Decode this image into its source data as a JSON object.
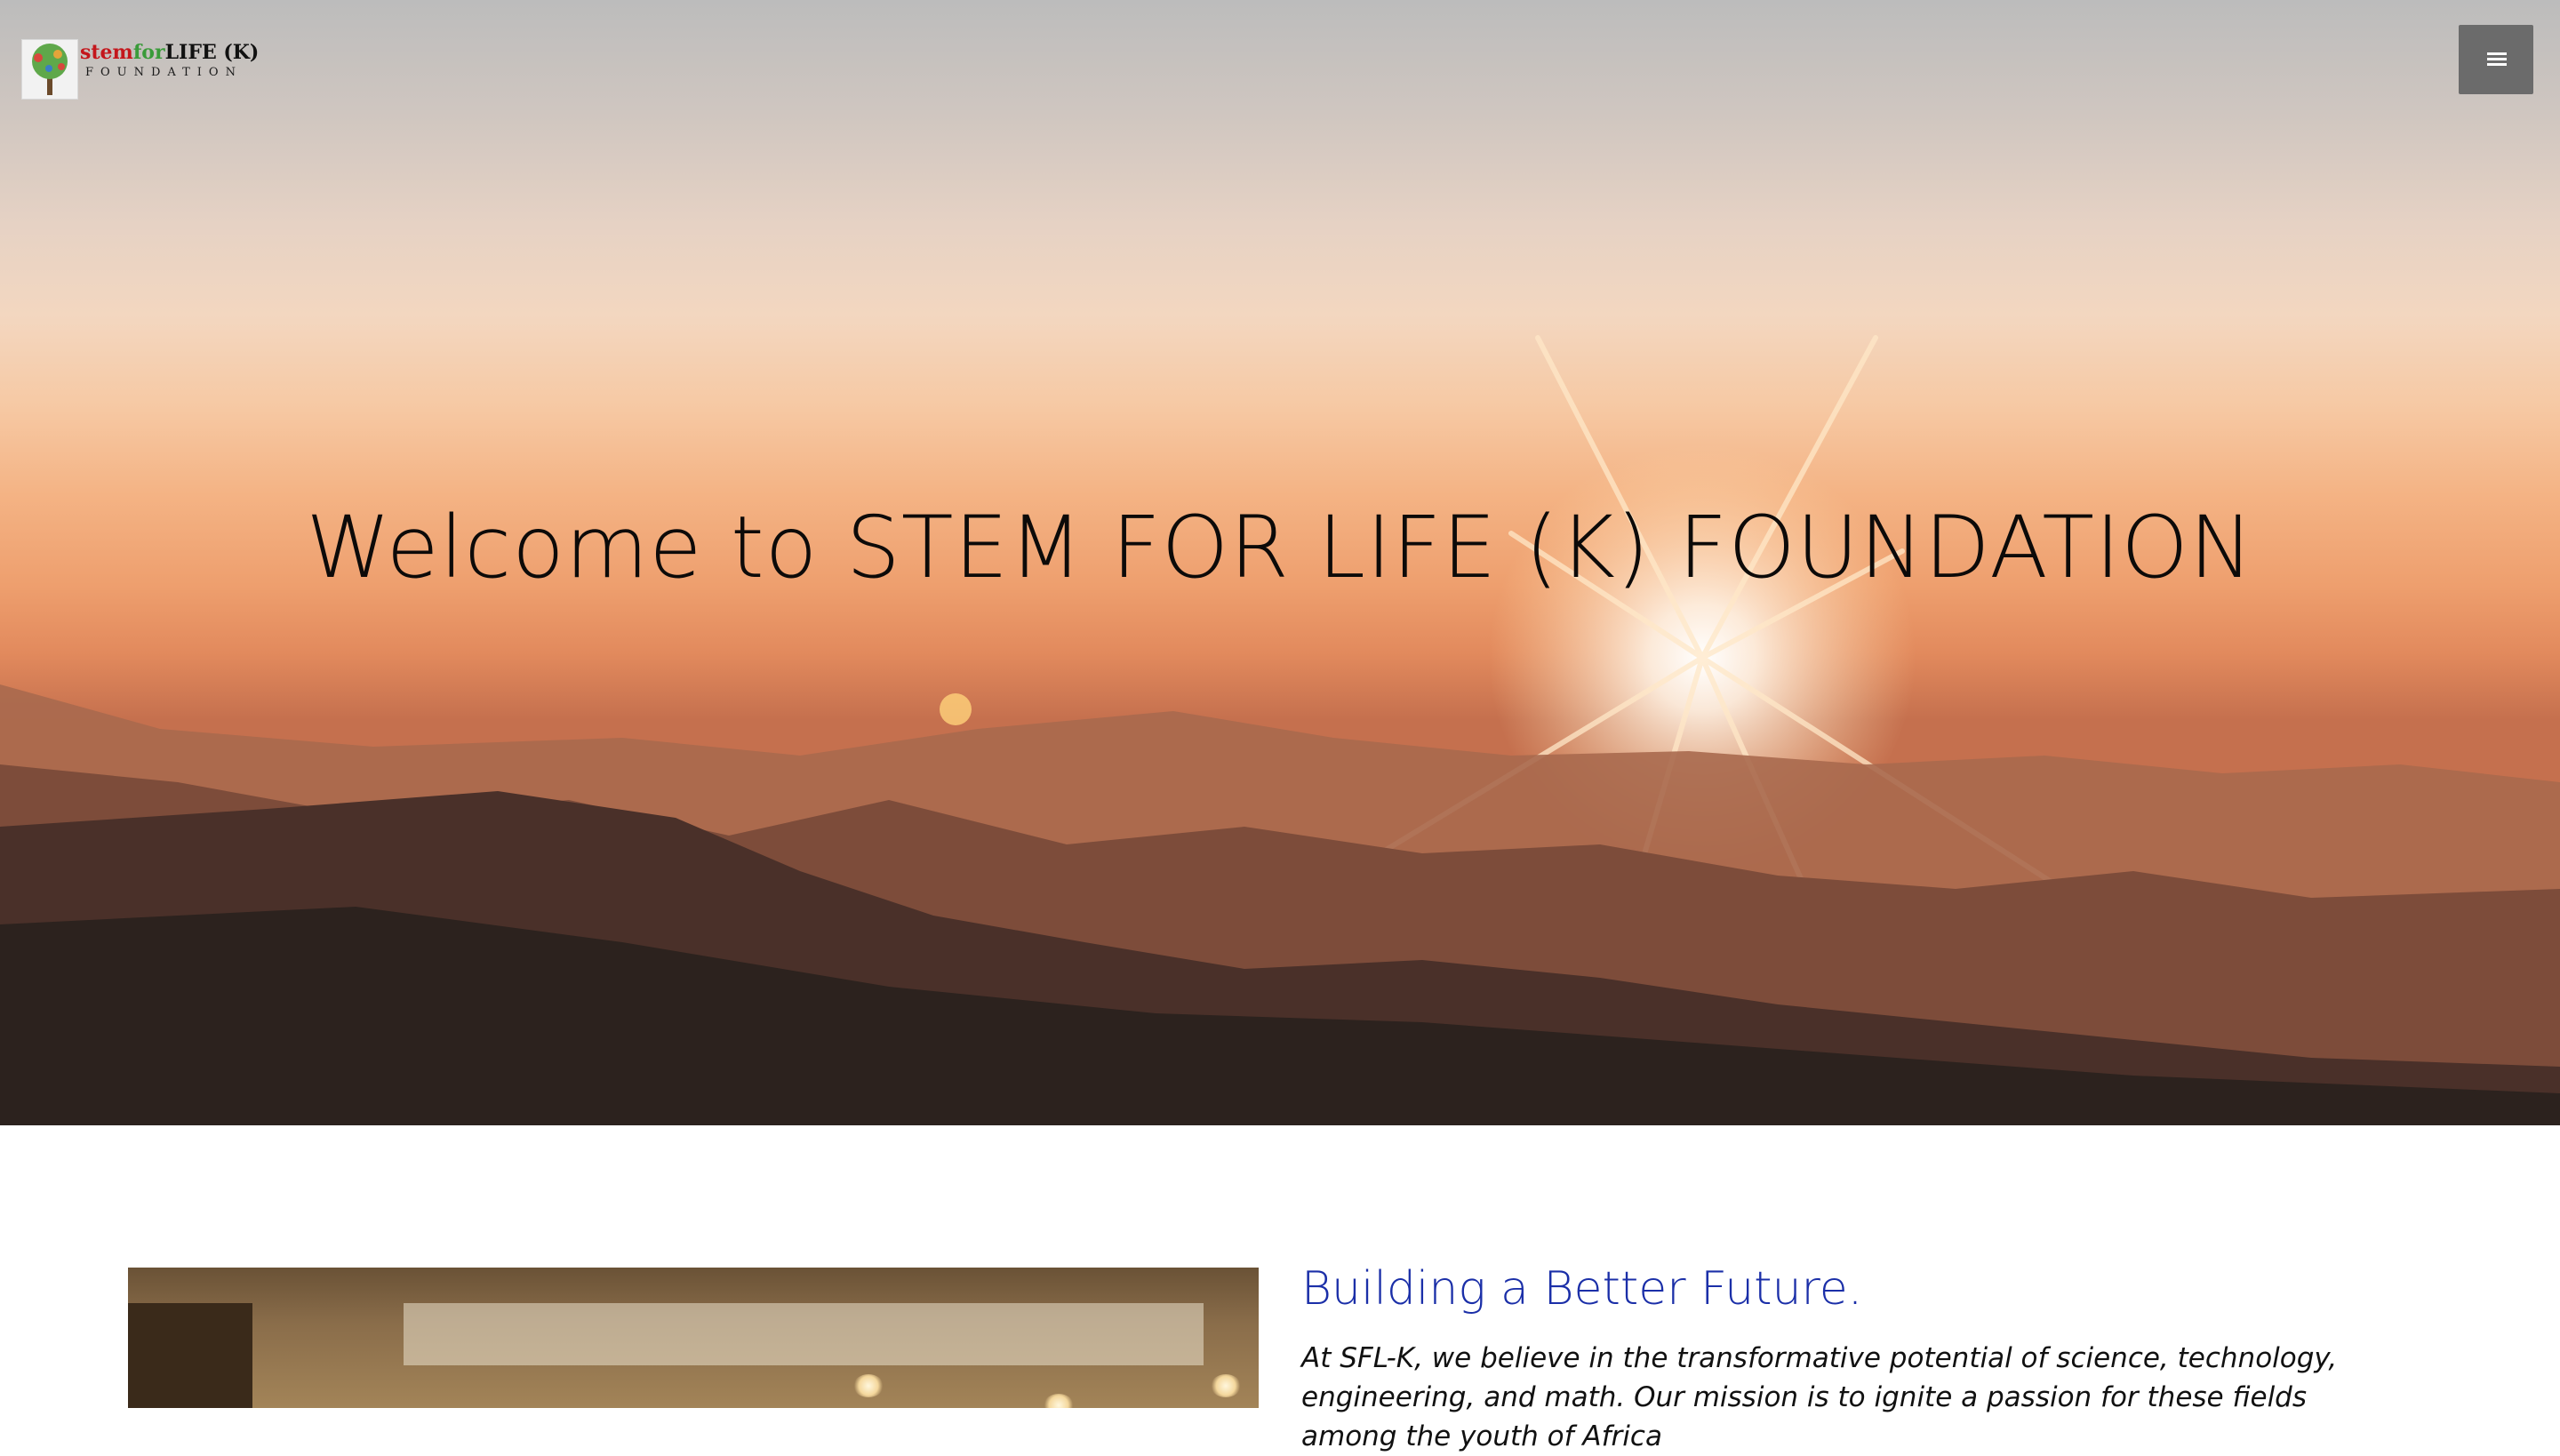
{
  "header": {
    "logo": {
      "word_stem": "stem",
      "word_for": "for",
      "word_life": "LIFE (K)",
      "subtitle": "FOUNDATION"
    },
    "menu_icon": "hamburger-icon"
  },
  "hero": {
    "title": "Welcome to STEM FOR LIFE (K) FOUNDATION"
  },
  "main": {
    "heading": "Building a Better Future.",
    "paragraph": "At SFL-K, we believe in the transformative potential of science, technology, engineering, and math. Our mission is to ignite a passion for these fields among the youth of Africa"
  },
  "colors": {
    "heading": "#1b2fa8",
    "menu_button": "#6b6b6b",
    "logo_stem": "#c4161c",
    "logo_for": "#3a9b3a"
  }
}
